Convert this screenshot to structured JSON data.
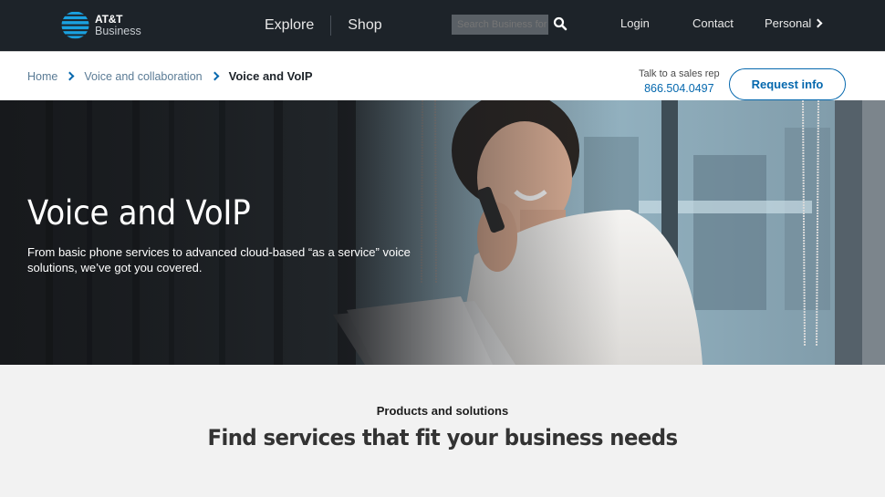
{
  "brand": {
    "name": "AT&T",
    "sub": "Business",
    "accent": "#0568ae",
    "globe_color": "#1aa1e0"
  },
  "nav": {
    "main": [
      {
        "label": "Explore"
      },
      {
        "label": "Shop"
      }
    ],
    "search": {
      "placeholder": "Search Business for ..."
    },
    "right": [
      {
        "label": "Login"
      },
      {
        "label": "Contact"
      },
      {
        "label": "Personal"
      }
    ]
  },
  "breadcrumb": {
    "items": [
      {
        "label": "Home"
      },
      {
        "label": "Voice and collaboration"
      },
      {
        "label": "Voice and VoIP"
      }
    ]
  },
  "sales": {
    "label": "Talk to a sales rep",
    "phone": "866.504.0497",
    "request_label": "Request info"
  },
  "hero": {
    "title": "Voice and VoIP",
    "subtitle": "From basic phone services to advanced cloud-based “as a service” voice solutions, we’ve got you covered.",
    "image": "woman-on-phone-by-window"
  },
  "products": {
    "eyebrow": "Products and solutions",
    "title": "Find services that fit your business needs"
  }
}
